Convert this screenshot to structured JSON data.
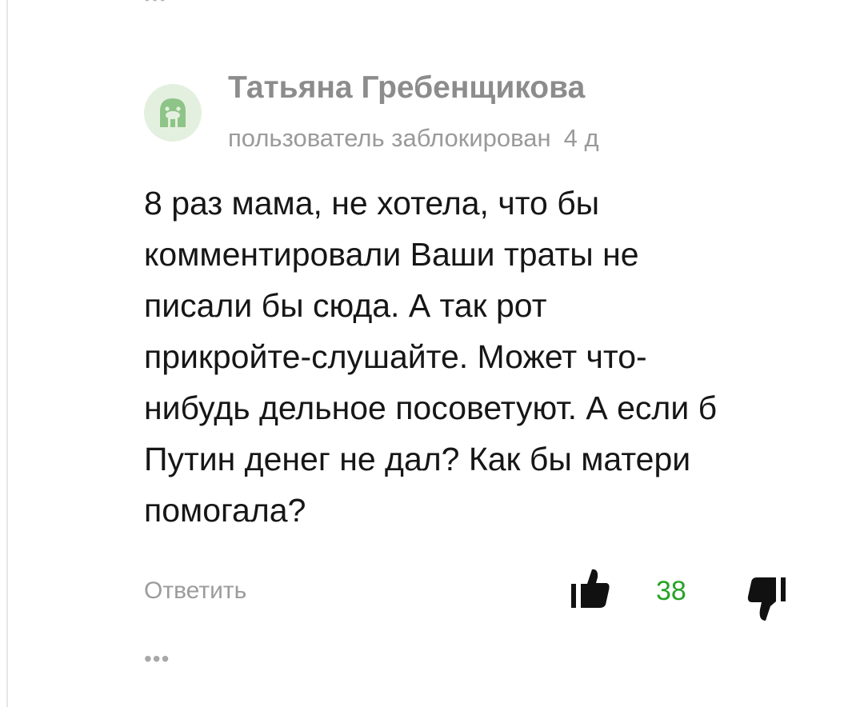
{
  "comment": {
    "author": "Татьяна Гребенщикова",
    "status": "пользователь заблокирован",
    "age": "4 д",
    "text": "8 раз мама, не хотела, что бы\nкомментировали Ваши траты не\nписали бы сюда. А так рот\nприкройте-слушайте. Может что-\nнибудь дельное посоветуют. А если б\nПутин денег не дал? Как бы матери\nпомогала?",
    "reply_label": "Ответить",
    "likes": "38",
    "more_glyph": "•••"
  },
  "top": {
    "more_glyph": "•••"
  },
  "icons": {
    "avatar": "walrus-icon",
    "like": "thumbs-up-icon",
    "dislike": "thumbs-down-icon",
    "more": "more-dots-icon"
  },
  "colors": {
    "author": "#8c8c8c",
    "meta": "#9a9a9a",
    "text": "#161616",
    "likes": "#25a326",
    "avatar_bg": "#e4f0df",
    "avatar_fg": "#8ec487"
  }
}
